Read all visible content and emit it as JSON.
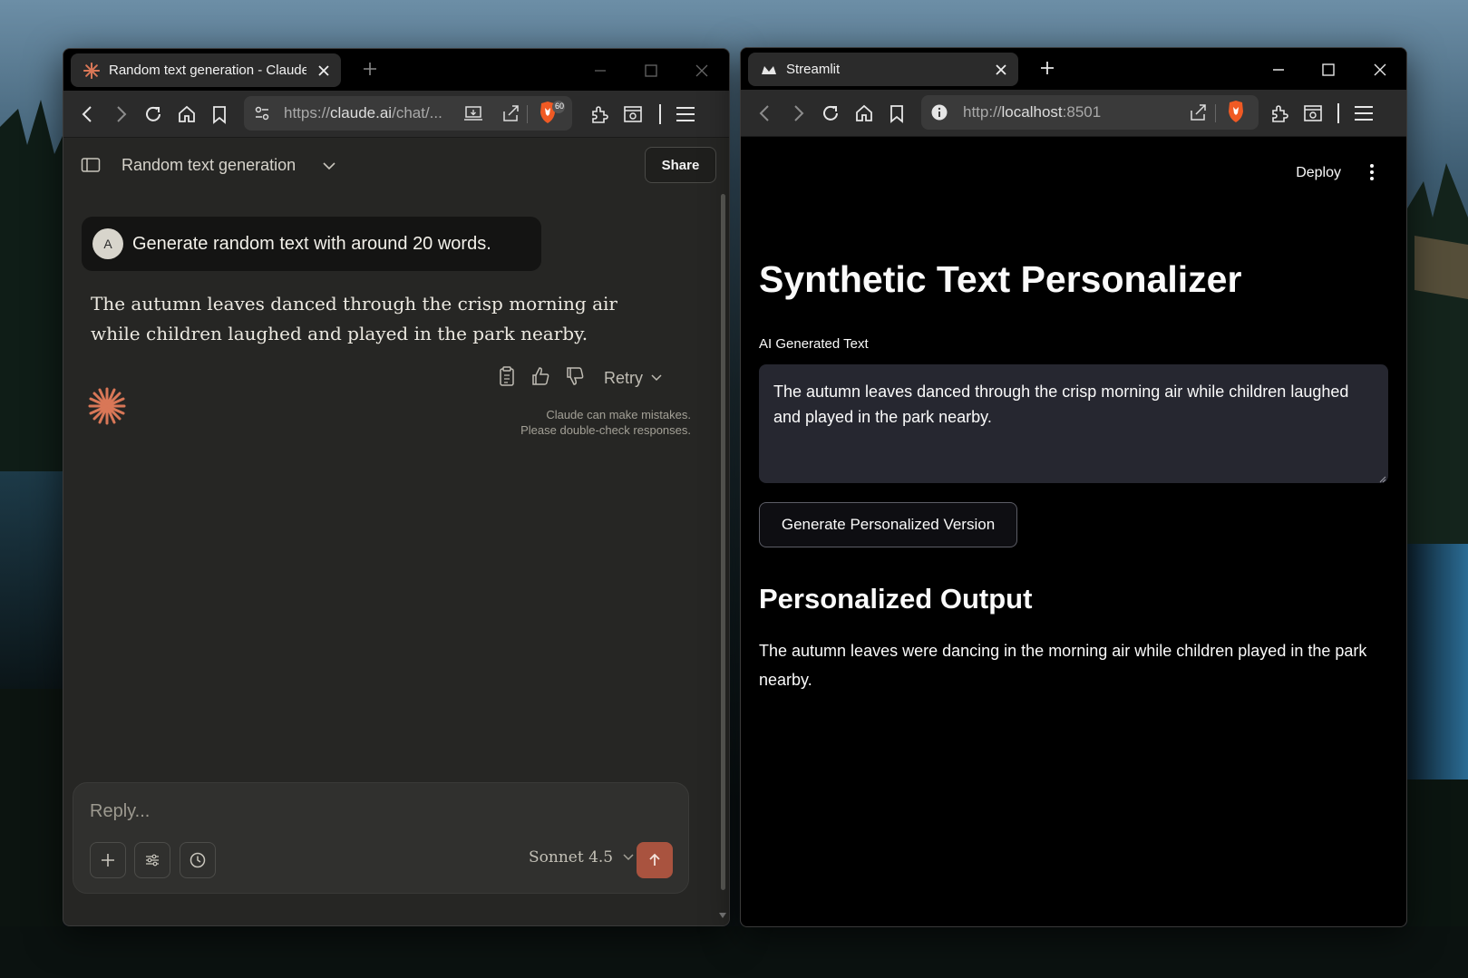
{
  "left_window": {
    "tab_title": "Random text generation - Claude",
    "url_prefix": "https://",
    "url_host": "claude.ai",
    "url_path": "/chat/...",
    "shield_count": "60",
    "conversation_title": "Random text generation",
    "share_label": "Share",
    "user_initial": "A",
    "user_message": "Generate random text with around 20 words.",
    "assistant_message": "The autumn leaves danced through the crisp morning air while children laughed and played in the park nearby.",
    "retry_label": "Retry",
    "disclaimer_line1": "Claude can make mistakes.",
    "disclaimer_line2": "Please double-check responses.",
    "composer_placeholder": "Reply...",
    "model_label": "Sonnet 4.5",
    "accent_color": "#d97757",
    "send_color": "#a9533f"
  },
  "right_window": {
    "tab_title": "Streamlit",
    "url_prefix": "http://",
    "url_host": "localhost",
    "url_port": ":8501",
    "deploy_label": "Deploy",
    "app_title": "Synthetic Text Personalizer",
    "textarea_label": "AI Generated Text",
    "textarea_value": "The autumn leaves danced through the crisp morning air while children laughed and played in the park nearby.",
    "button_label": "Generate Personalized Version",
    "output_heading": "Personalized Output",
    "output_text": "The autumn leaves were dancing in the morning air while children played in the park nearby."
  }
}
